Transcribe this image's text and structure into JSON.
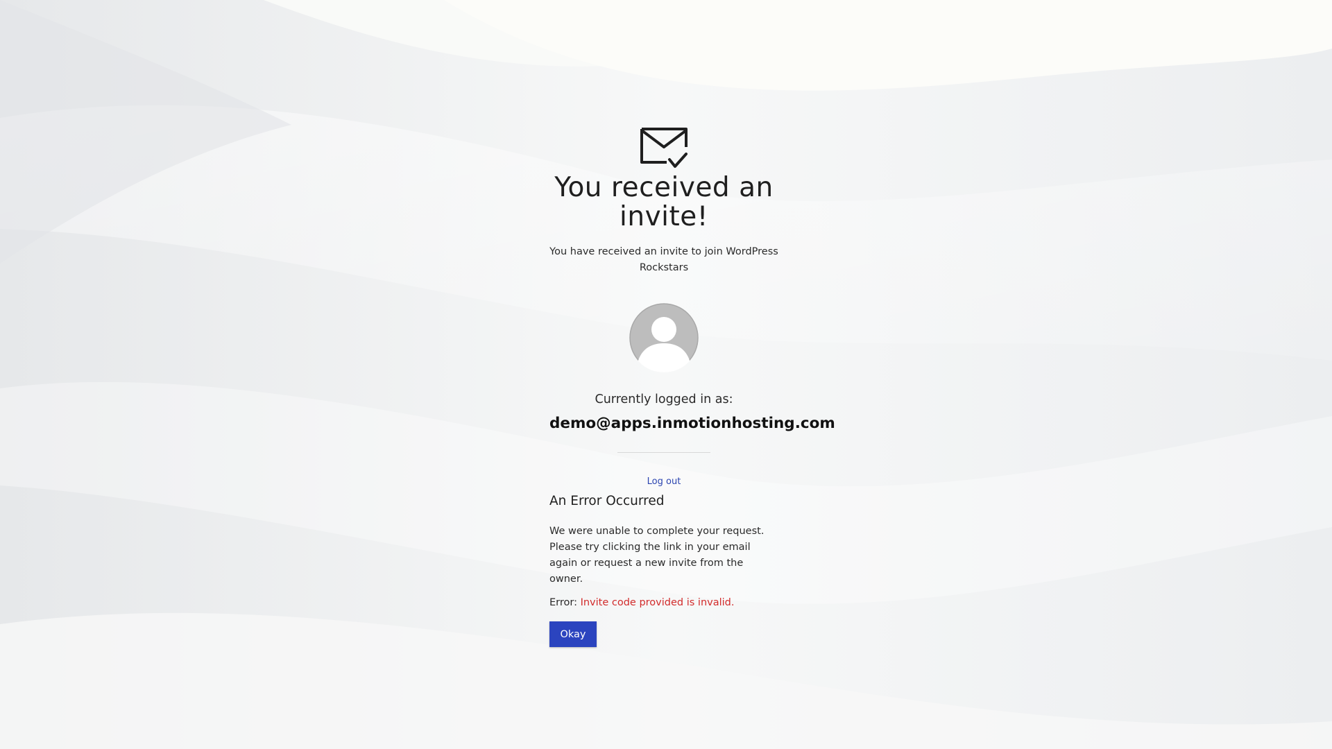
{
  "invite": {
    "heading": "You received an invite!",
    "subtitle": "You have received an invite to join WordPress Rockstars"
  },
  "account": {
    "logged_in_label": "Currently logged in as:",
    "email": "demo@apps.inmotionhosting.com",
    "logout_label": "Log out"
  },
  "error": {
    "heading": "An Error Occurred",
    "body": "We were unable to complete your request. Please try clicking the link in your email again or request a new invite from the owner.",
    "prefix": "Error:",
    "message": "Invite code provided is invalid."
  },
  "actions": {
    "okay_label": "Okay"
  },
  "icons": {
    "envelope": "envelope-check-icon",
    "avatar": "default-avatar-icon"
  },
  "colors": {
    "accent": "#2b44bf",
    "link": "#2b44b0",
    "error": "#d22b2b",
    "text": "#1f1f1f"
  }
}
